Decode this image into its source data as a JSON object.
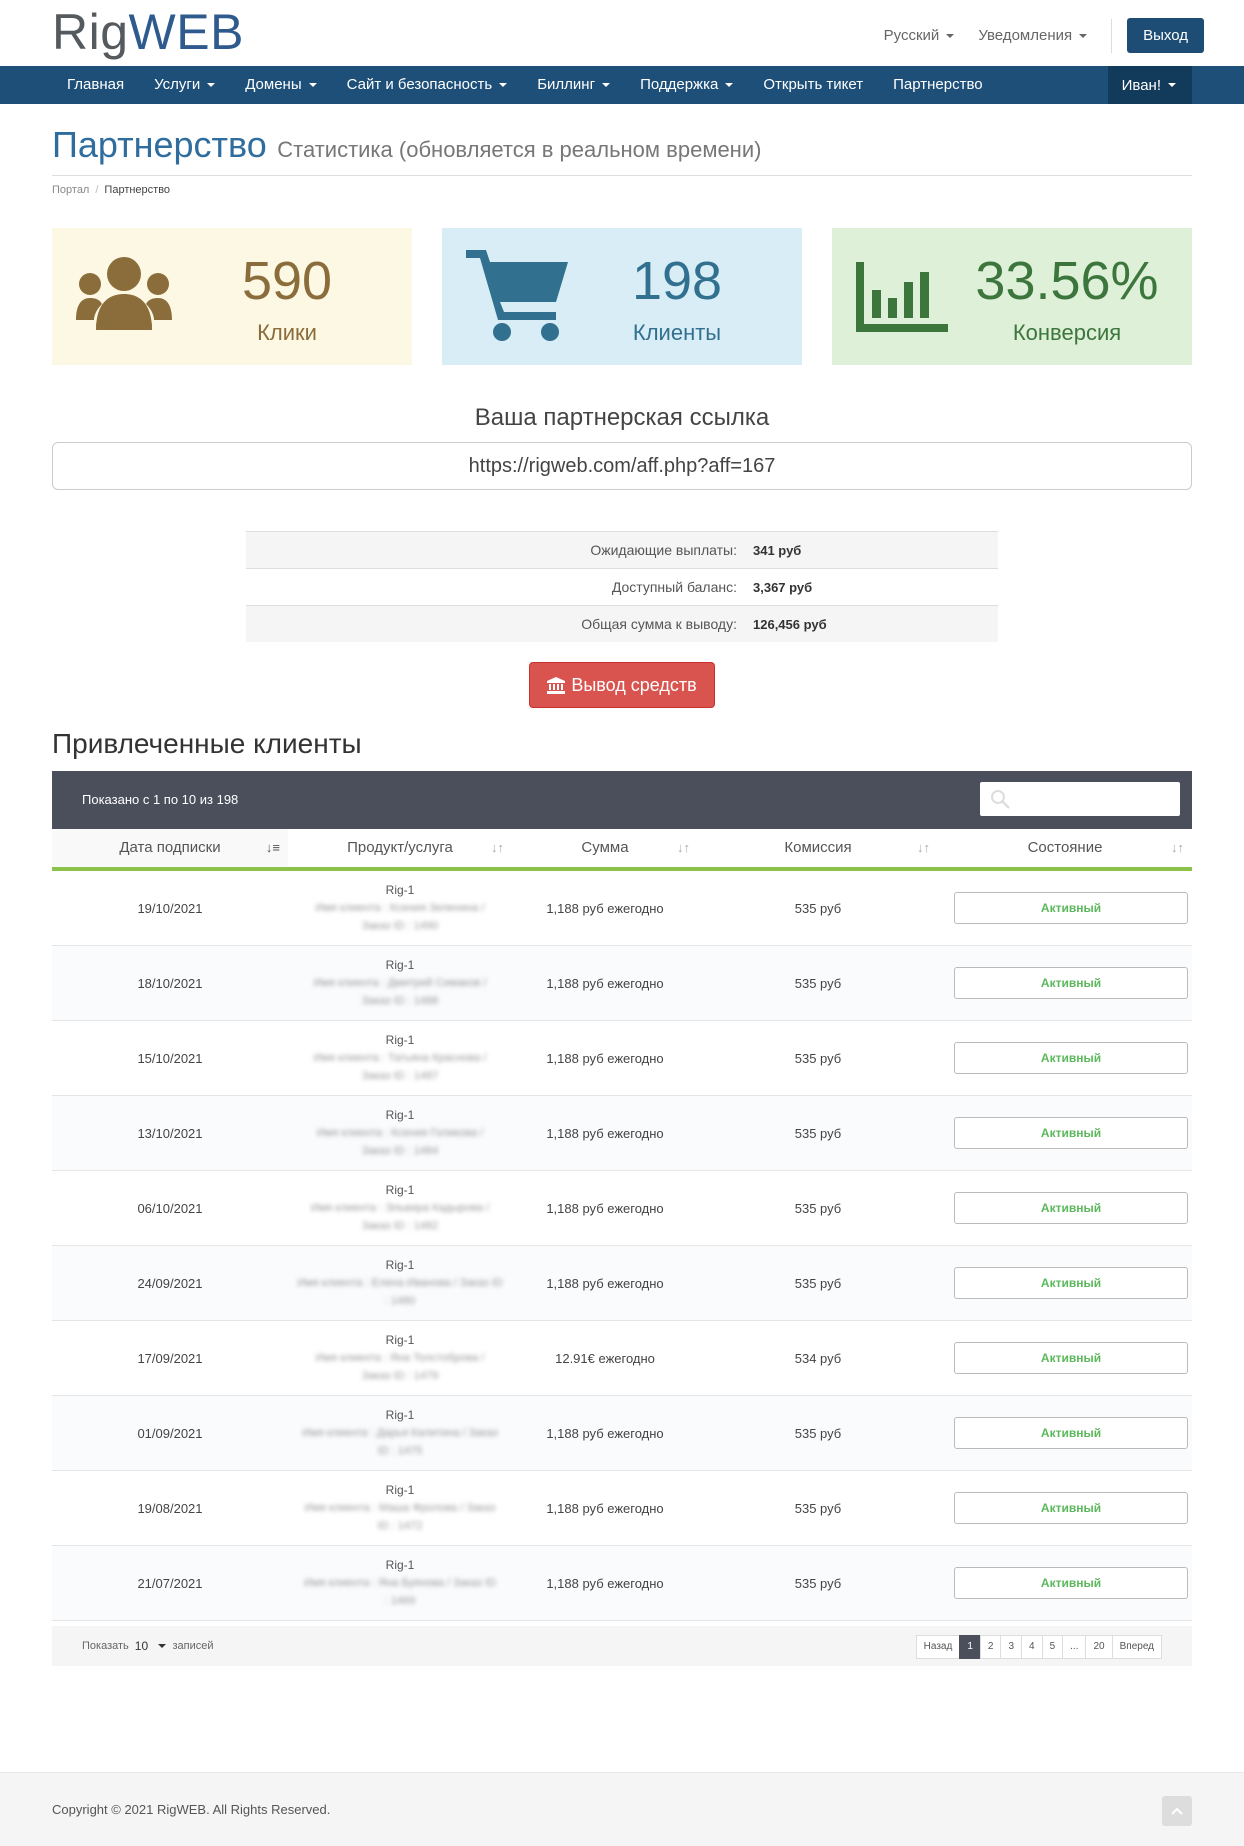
{
  "brand": {
    "rig": "Rig",
    "web": "WEB"
  },
  "top": {
    "language": "Русский",
    "notifications": "Уведомления",
    "logout": "Выход"
  },
  "nav": {
    "items": [
      "Главная",
      "Услуги",
      "Домены",
      "Сайт и безопасность",
      "Биллинг",
      "Поддержка",
      "Открыть тикет",
      "Партнерство"
    ],
    "user": "Иван!"
  },
  "page": {
    "title": "Партнерство",
    "subtitle": "Статистика (обновляется в реальном времени)",
    "breadcrumb": [
      "Портал",
      "Партнерство"
    ]
  },
  "stats": {
    "clicks": {
      "value": "590",
      "label": "Клики"
    },
    "clients": {
      "value": "198",
      "label": "Клиенты"
    },
    "conversion": {
      "value": "33.56%",
      "label": "Конверсия"
    }
  },
  "affiliate": {
    "title": "Ваша партнерская ссылка",
    "link": "https://rigweb.com/aff.php?aff=167"
  },
  "balance": [
    {
      "label": "Ожидающие выплаты:",
      "value": "341 руб"
    },
    {
      "label": "Доступный баланс:",
      "value": "3,367 руб"
    },
    {
      "label": "Общая сумма к выводу:",
      "value": "126,456 руб"
    }
  ],
  "withdraw_label": "Вывод средств",
  "referrals": {
    "title": "Привлеченные клиенты",
    "info": "Показано с 1 по 10 из 198",
    "columns": [
      "Дата подписки",
      "Продукт/услуга",
      "Сумма",
      "Комиссия",
      "Состояние"
    ],
    "rows": [
      {
        "date": "19/10/2021",
        "product": "Rig-1",
        "client": "Имя клиента : Ксения Зеленина /",
        "order": "Заказ ID : 1490",
        "amount": "1,188 руб ежегодно",
        "commission": "535 руб",
        "status": "Активный"
      },
      {
        "date": "18/10/2021",
        "product": "Rig-1",
        "client": "Имя клиента : Дмитрий Симаков /",
        "order": "Заказ ID : 1488",
        "amount": "1,188 руб ежегодно",
        "commission": "535 руб",
        "status": "Активный"
      },
      {
        "date": "15/10/2021",
        "product": "Rig-1",
        "client": "Имя клиента : Татьяна Краснова /",
        "order": "Заказ ID : 1487",
        "amount": "1,188 руб ежегодно",
        "commission": "535 руб",
        "status": "Активный"
      },
      {
        "date": "13/10/2021",
        "product": "Rig-1",
        "client": "Имя клиента : Ксения Голикова /",
        "order": "Заказ ID : 1484",
        "amount": "1,188 руб ежегодно",
        "commission": "535 руб",
        "status": "Активный"
      },
      {
        "date": "06/10/2021",
        "product": "Rig-1",
        "client": "Имя клиента : Эльвира Кадырова /",
        "order": "Заказ ID : 1482",
        "amount": "1,188 руб ежегодно",
        "commission": "535 руб",
        "status": "Активный"
      },
      {
        "date": "24/09/2021",
        "product": "Rig-1",
        "client": "Имя клиента : Елена Иванова / Заказ ID",
        "order": ": 1480",
        "amount": "1,188 руб ежегодно",
        "commission": "535 руб",
        "status": "Активный"
      },
      {
        "date": "17/09/2021",
        "product": "Rig-1",
        "client": "Имя клиента : Яна Толстоброва /",
        "order": "Заказ ID : 1479",
        "amount": "12.91€ ежегодно",
        "commission": "534 руб",
        "status": "Активный"
      },
      {
        "date": "01/09/2021",
        "product": "Rig-1",
        "client": "Имя клиента : Дарья Калитина / Заказ",
        "order": "ID : 1475",
        "amount": "1,188 руб ежегодно",
        "commission": "535 руб",
        "status": "Активный"
      },
      {
        "date": "19/08/2021",
        "product": "Rig-1",
        "client": "Имя клиента : Маша Фролова / Заказ",
        "order": "ID : 1472",
        "amount": "1,188 руб ежегодно",
        "commission": "535 руб",
        "status": "Активный"
      },
      {
        "date": "21/07/2021",
        "product": "Rig-1",
        "client": "Имя клиента : Яна Буянова / Заказ ID",
        "order": ": 1469",
        "amount": "1,188 руб ежегодно",
        "commission": "535 руб",
        "status": "Активный"
      }
    ],
    "show_label": "Показать",
    "show_value": "10",
    "show_suffix": "записей",
    "pager": {
      "prev": "Назад",
      "pages": [
        "1",
        "2",
        "3",
        "4",
        "5",
        "...",
        "20"
      ],
      "next": "Вперед",
      "current": "1"
    }
  },
  "footer": {
    "copyright": "Copyright © 2021 RigWEB. All Rights Reserved."
  },
  "colors": {
    "brand": "#1d4f78",
    "danger": "#d9534f",
    "success": "#5cb85c"
  }
}
